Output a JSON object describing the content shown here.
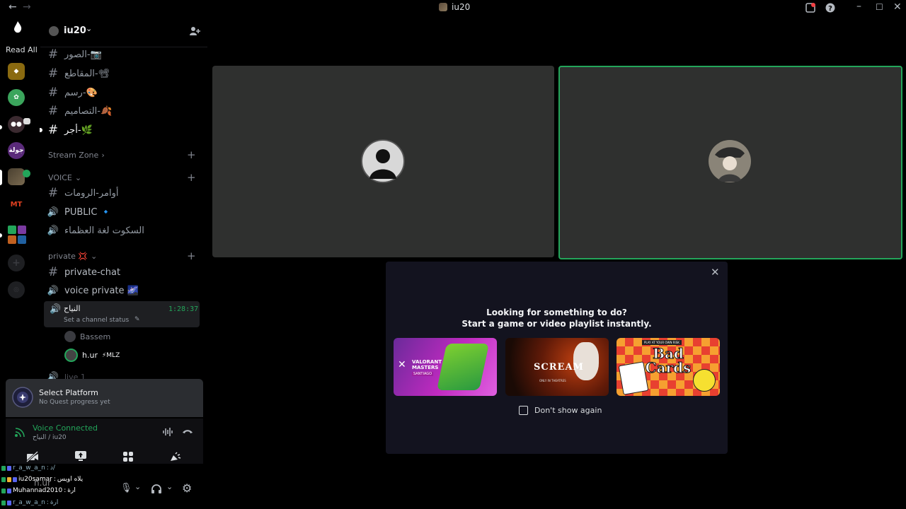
{
  "titlebar": {
    "title": "iu20"
  },
  "rail": {
    "read_all": "Read All",
    "server_badge_text": "جولة",
    "mt_text": "MT"
  },
  "sidebar": {
    "server_name": "iu20",
    "channels_top": [
      {
        "name": "الصور-📷"
      },
      {
        "name": "المقاطع-📽"
      },
      {
        "name": "رسم-🎨"
      },
      {
        "name": "التصاميم-🍂"
      },
      {
        "name": "أجر-🌿"
      }
    ],
    "cat_stream": "Stream Zone",
    "cat_voice": "VOICE",
    "voice_channels": [
      {
        "name": "أوامر-الرومات"
      },
      {
        "name": "PUBLIC 🔹"
      },
      {
        "name": "السكوت لغة العظماء"
      }
    ],
    "cat_private": "private 💢",
    "private_channels": [
      {
        "name": "private-chat"
      },
      {
        "name": "voice private 🌌"
      }
    ],
    "active_channel": {
      "name": "النياح",
      "timer": "1:28:37",
      "status": "Set a channel status"
    },
    "members": [
      {
        "name": "Bassem"
      },
      {
        "name": "h.ur",
        "tag": "⚡MLZ"
      }
    ],
    "partial_channel": "live 1"
  },
  "quest": {
    "title": "Select Platform",
    "subtitle": "No Quest progress yet"
  },
  "voice": {
    "status": "Voice Connected",
    "location": "النياح / iu20"
  },
  "chat_overlay": [
    {
      "user": "r_a_w_a_n",
      "text": "د/"
    },
    {
      "user": "iu20samar",
      "text": "يلاه اويس"
    },
    {
      "user": "Muhannad2010",
      "text": "ارة"
    },
    {
      "user": "r_a_w_a_n",
      "text": "ارة"
    }
  ],
  "userbar": {
    "name": "h.ur"
  },
  "modal": {
    "line1": "Looking for something to do?",
    "line2": "Start a game or video playlist instantly.",
    "checkbox_label": "Don't show again",
    "cards": [
      {
        "title": "VALORANT MASTERS",
        "sub": "SANTIAGO"
      },
      {
        "title": "SCREAM",
        "sub": "ONLY IN THEATRES"
      },
      {
        "title": "Bad Cards",
        "sub": "PLAY AT YOUR OWN RISK"
      }
    ]
  },
  "colors": {
    "accent_green": "#23a55a",
    "modal_bg": "#13131f",
    "tile_bg": "#2f302f"
  },
  "icons": [
    "back-arrow-icon",
    "forward-arrow-icon",
    "inbox-icon",
    "help-icon",
    "minimize-icon",
    "maximize-icon",
    "close-icon",
    "hash-icon",
    "speaker-icon",
    "add-user-icon",
    "signal-icon",
    "soundboard-icon",
    "disconnect-icon",
    "camera-off-icon",
    "screen-share-icon",
    "activities-icon",
    "soundboard-icon",
    "mic-icon",
    "headphones-icon",
    "settings-icon",
    "plus-icon"
  ]
}
